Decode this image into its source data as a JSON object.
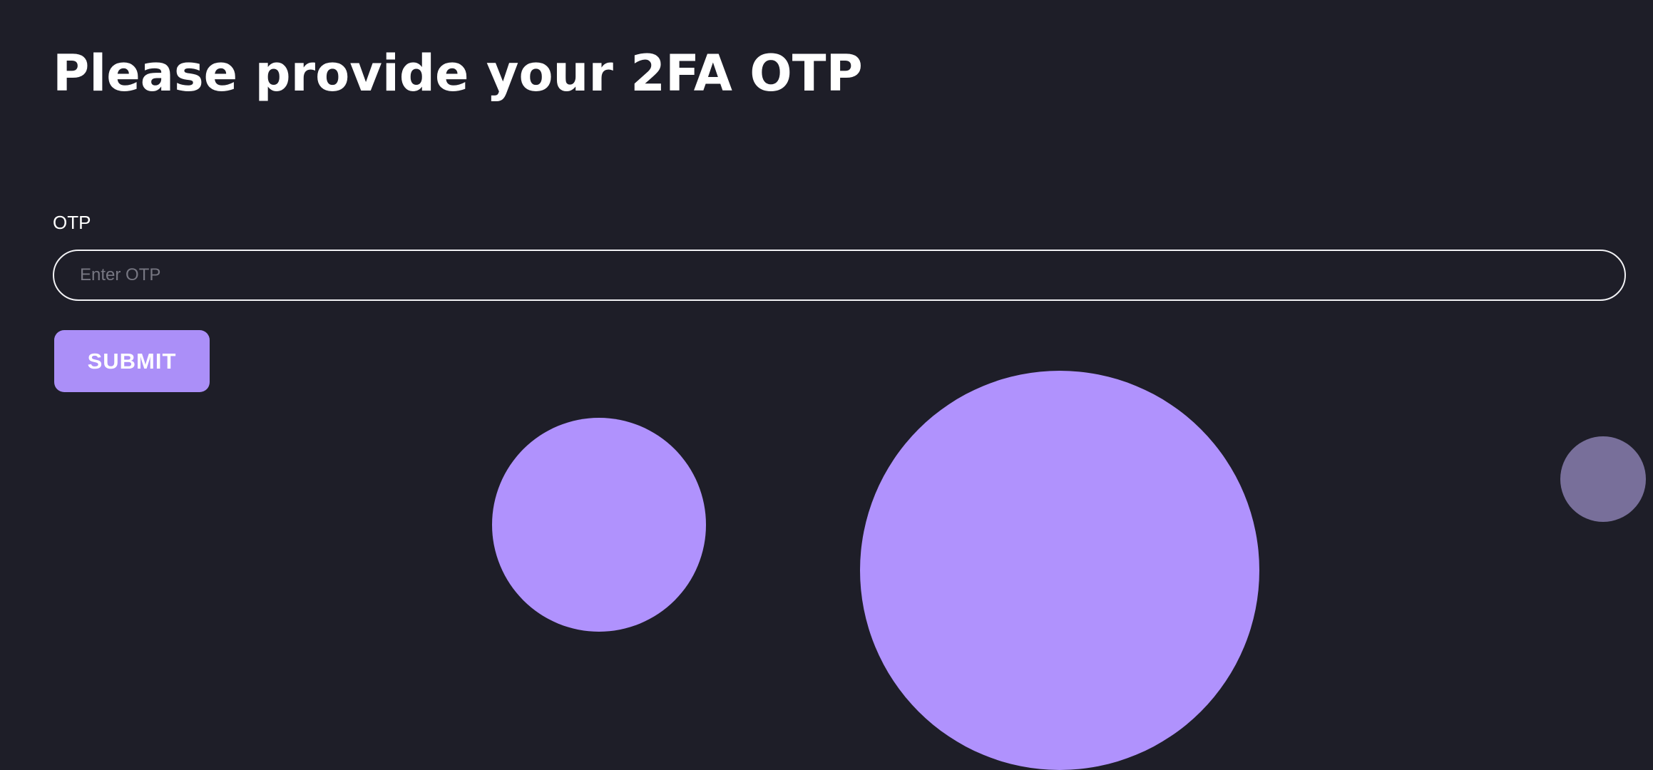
{
  "page": {
    "title": "Please provide your 2FA OTP"
  },
  "form": {
    "otp_label": "OTP",
    "otp_placeholder": "Enter OTP",
    "otp_value": "",
    "submit_label": "SUBMIT"
  },
  "colors": {
    "background": "#1e1e28",
    "accent": "#ab8ff8",
    "text": "#ffffff",
    "placeholder": "#777782"
  }
}
